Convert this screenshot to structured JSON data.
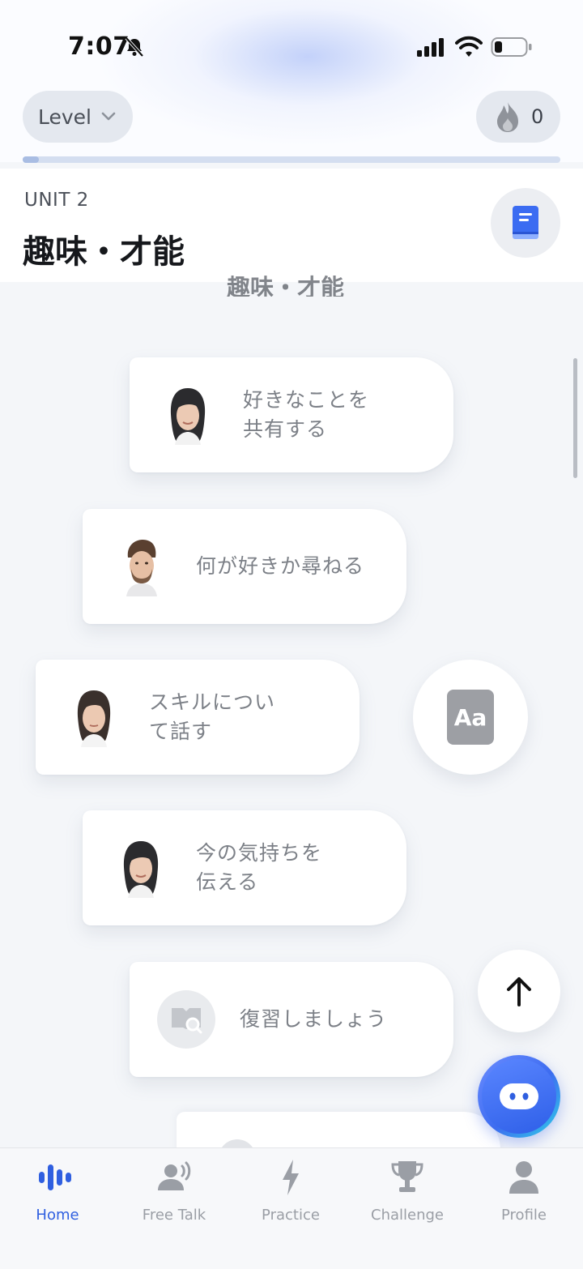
{
  "status_bar": {
    "time": "7:07"
  },
  "header": {
    "level_label": "Level",
    "streak_count": "0",
    "progress": 0.03
  },
  "unit": {
    "label": "UNIT 2",
    "title": "趣味・才能",
    "ghost_title": "趣味・才能"
  },
  "lessons": [
    {
      "label": "好きなことを\n共有する",
      "avatar": "woman-portrait"
    },
    {
      "label": "何が好きか尋ねる",
      "avatar": "man-portrait"
    },
    {
      "label": "スキルについ\nて話す",
      "avatar": "woman-portrait"
    },
    {
      "label": "今の気持ちを\n伝える",
      "avatar": "woman-portrait"
    },
    {
      "label": "復習しましょう",
      "avatar": "review-search-icon"
    }
  ],
  "vocab_button": {
    "label": "Aa"
  },
  "tabs": [
    {
      "label": "Home",
      "icon": "voice-wave-icon",
      "active": true
    },
    {
      "label": "Free Talk",
      "icon": "speaking-person-icon",
      "active": false
    },
    {
      "label": "Practice",
      "icon": "lightning-icon",
      "active": false
    },
    {
      "label": "Challenge",
      "icon": "trophy-icon",
      "active": false
    },
    {
      "label": "Profile",
      "icon": "person-icon",
      "active": false
    }
  ],
  "colors": {
    "accent": "#2f5fe0",
    "inactive": "#9a9ea5",
    "card_text": "#7c8087"
  }
}
